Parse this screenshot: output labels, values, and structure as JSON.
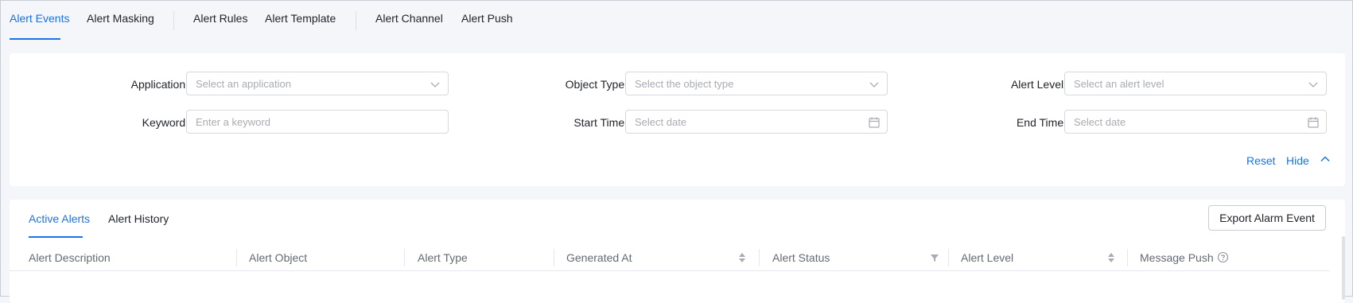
{
  "top_tabs": [
    {
      "label": "Alert Events",
      "active": true
    },
    {
      "label": "Alert Masking"
    },
    {
      "label": "Alert Rules"
    },
    {
      "label": "Alert Template"
    },
    {
      "label": "Alert Channel"
    },
    {
      "label": "Alert Push"
    }
  ],
  "filters": {
    "application": {
      "label": "Application:",
      "placeholder": "Select an application"
    },
    "object_type": {
      "label": "Object Type:",
      "placeholder": "Select the object type"
    },
    "alert_level": {
      "label": "Alert Level:",
      "placeholder": "Select an alert level"
    },
    "keyword": {
      "label": "Keyword:",
      "placeholder": "Enter a keyword"
    },
    "start_time": {
      "label": "Start Time:",
      "placeholder": "Select date"
    },
    "end_time": {
      "label": "End Time:",
      "placeholder": "Select date"
    },
    "reset_label": "Reset",
    "hide_label": "Hide"
  },
  "table": {
    "tabs": [
      {
        "label": "Active Alerts",
        "active": true
      },
      {
        "label": "Alert History"
      }
    ],
    "export_label": "Export Alarm Event",
    "columns": [
      {
        "label": "Alert Description"
      },
      {
        "label": "Alert Object"
      },
      {
        "label": "Alert Type"
      },
      {
        "label": "Generated At",
        "control": "sort"
      },
      {
        "label": "Alert Status",
        "control": "filter"
      },
      {
        "label": "Alert Level",
        "control": "sort"
      },
      {
        "label": "Message Push",
        "control": "help"
      }
    ]
  },
  "colors": {
    "accent": "#1a73e8",
    "background": "#f4f6fa"
  }
}
